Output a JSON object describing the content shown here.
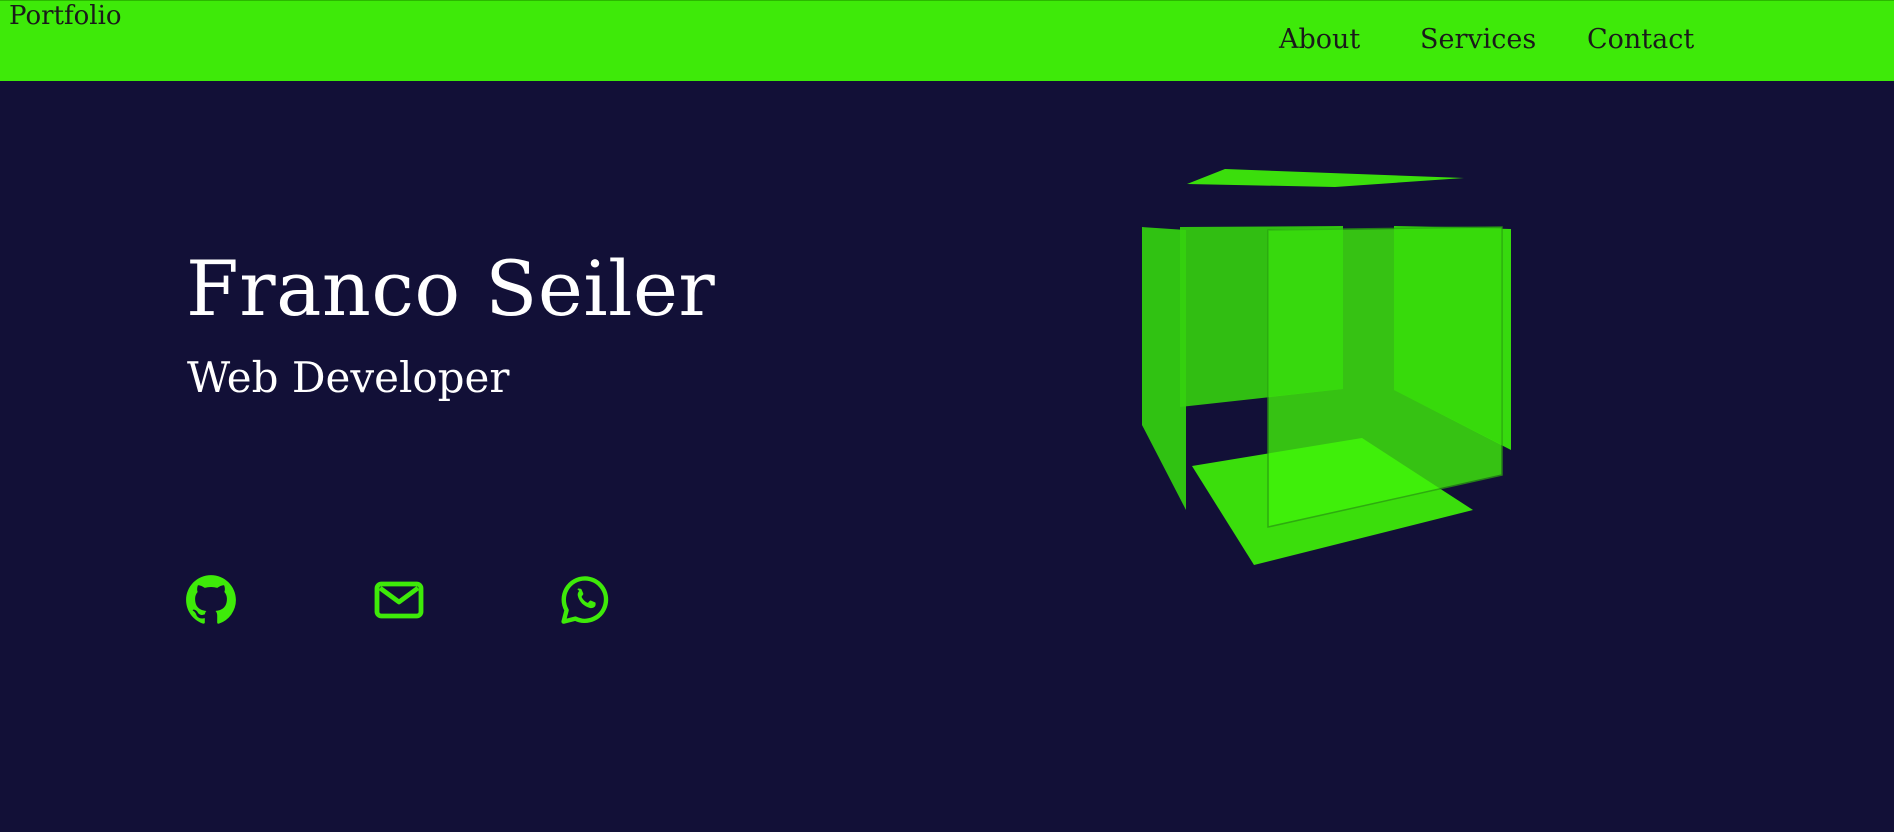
{
  "nav": {
    "brand": "Portfolio",
    "links": [
      {
        "label": "About"
      },
      {
        "label": "Services"
      },
      {
        "label": "Contact"
      }
    ]
  },
  "hero": {
    "name": "Franco Seiler",
    "role": "Web Developer"
  },
  "social": [
    {
      "icon": "github-icon"
    },
    {
      "icon": "mail-icon"
    },
    {
      "icon": "whatsapp-icon"
    }
  ],
  "colors": {
    "accent": "#3eea09",
    "background": "#121037",
    "text": "#ffffff",
    "nav_text": "#1a1a1a"
  }
}
